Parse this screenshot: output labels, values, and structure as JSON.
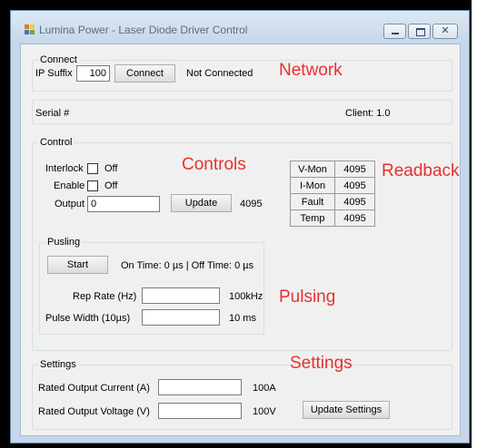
{
  "window": {
    "title": "Lumina Power - Laser Diode Driver Control",
    "controls": {
      "minimize": "minimize-icon",
      "maximize": "maximize-icon",
      "close": "close-icon"
    }
  },
  "connect": {
    "group_label": "Connect",
    "ip_label": "IP Suffix",
    "ip_value": "100",
    "connect_button": "Connect",
    "status": "Not Connected"
  },
  "info": {
    "serial_label": "Serial #",
    "client_version": "Client: 1.0"
  },
  "control": {
    "group_label": "Control",
    "interlock_label": "Interlock",
    "interlock_state": "Off",
    "enable_label": "Enable",
    "enable_state": "Off",
    "output_label": "Output",
    "output_value": "0",
    "update_button": "Update",
    "output_readout": "4095"
  },
  "readback": [
    {
      "label": "V-Mon",
      "value": "4095"
    },
    {
      "label": "I-Mon",
      "value": "4095"
    },
    {
      "label": "Fault",
      "value": "4095"
    },
    {
      "label": "Temp",
      "value": "4095"
    }
  ],
  "pulsing": {
    "group_label": "Pusling",
    "start_button": "Start",
    "timing": "On Time: 0 µs | Off Time: 0 µs",
    "rep_rate_label": "Rep Rate (Hz)",
    "rep_rate_value": "",
    "rep_rate_unit": "100kHz",
    "pulse_width_label": "Pulse Width (10µs)",
    "pulse_width_value": "",
    "pulse_width_unit": "10 ms"
  },
  "settings": {
    "group_label": "Settings",
    "current_label": "Rated Output Current (A)",
    "current_value": "",
    "current_unit": "100A",
    "voltage_label": "Rated Output Voltage (V)",
    "voltage_value": "",
    "voltage_unit": "100V",
    "update_button": "Update Settings"
  },
  "annotations": {
    "network": "Network",
    "controls": "Controls",
    "readback": "Readback",
    "pulsing": "Pulsing",
    "settings": "Settings",
    "color": "#e8312d"
  },
  "colors": {
    "titlebar": "#c7d8eb",
    "client_bg": "#f0f0f0"
  }
}
